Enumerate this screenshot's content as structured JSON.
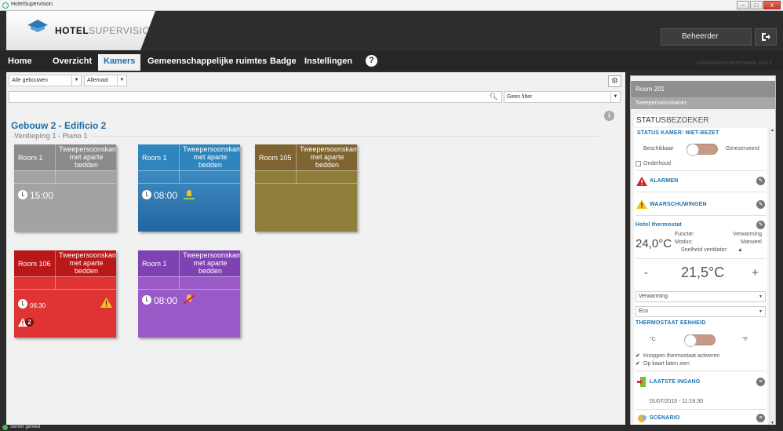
{
  "window": {
    "title": "HotelSupervision",
    "buttons": [
      "–",
      "□",
      "x"
    ]
  },
  "brand": {
    "bold": "HOTEL",
    "light": "SUPERVISION",
    "small": "LEGRANDGROUPSOFTWARE 2016 ©"
  },
  "user": {
    "name": "Beheerder",
    "logout_icon": "logout-icon"
  },
  "nav": {
    "items": [
      {
        "label": "Home",
        "active": false
      },
      {
        "label": "Overzicht",
        "active": false
      },
      {
        "label": "Kamers",
        "active": true
      },
      {
        "label": "Gemeenschappelijke ruimtes",
        "active": false
      },
      {
        "label": "Badge",
        "active": false
      },
      {
        "label": "Instellingen",
        "active": false
      }
    ],
    "help": "?"
  },
  "filters": {
    "building": "Alle gebouwen",
    "status": "Allemaal",
    "filter": "Geen filter",
    "search_placeholder": ""
  },
  "building": {
    "title": "Gebouw 2 - Edificio 2",
    "floor": "Verdieping 1 - Piano 1"
  },
  "rooms": [
    {
      "name": "Room 1",
      "type": "Tweepersoonskamer met aparte bedden",
      "time": "15:00",
      "color": "#9a9a9a"
    },
    {
      "name": "Room 1",
      "type": "Tweepersoonskamer met aparte bedden",
      "time": "08:00",
      "color": "#2f7fb6"
    },
    {
      "name": "Room 105",
      "type": "Tweepersoonskamer met aparte bedden",
      "time": "",
      "color": "#8a7338"
    },
    {
      "name": "Room 106",
      "type": "Tweepersoonskamer met aparte bedden",
      "time": "06:30",
      "color": "#d42a2a",
      "alarms": "2"
    },
    {
      "name": "Room 1",
      "type": "Tweepersoonskamer met aparte bedden",
      "time": "08:00",
      "color": "#8a4cc0"
    }
  ],
  "detail": {
    "room": "Room 201",
    "type": "Tweepersoonskamer",
    "tabs": [
      "STATUS",
      "BEZOEKER"
    ],
    "status_line": "STATUS KAMER: NIET-BEZET",
    "toggle_left": "Beschikbaar",
    "toggle_right": "Gereserveerd",
    "maintenance": "Onderhoud",
    "alarms": "ALARMEN",
    "warnings": "WAARSCHUWINGEN",
    "thermostat_title": "Hotel thermostat",
    "current_temp": "24,0°C",
    "func_label": "Functie:",
    "func_value": "Verwarming",
    "mode_label": "Modus:",
    "mode_value": "Manueel",
    "fan_label": "Snelheid ventilator:",
    "setpoint": "21,5°C",
    "minus": "-",
    "plus": "+",
    "select_mode": "Verwarming",
    "select_eco": "Eco",
    "unit_title": "THERMOSTAAT EENHEID",
    "unit_c": "°C",
    "unit_f": "°F",
    "check1": "Knoppen thermostaat activeren",
    "check2": "Op kaart laten zien",
    "last_entry": "LAATSTE INGANG",
    "last_entry_value": "01/07/2015 - 11:16:30",
    "scenario": "SCENARIO"
  },
  "status": {
    "text": "Server gereed"
  }
}
